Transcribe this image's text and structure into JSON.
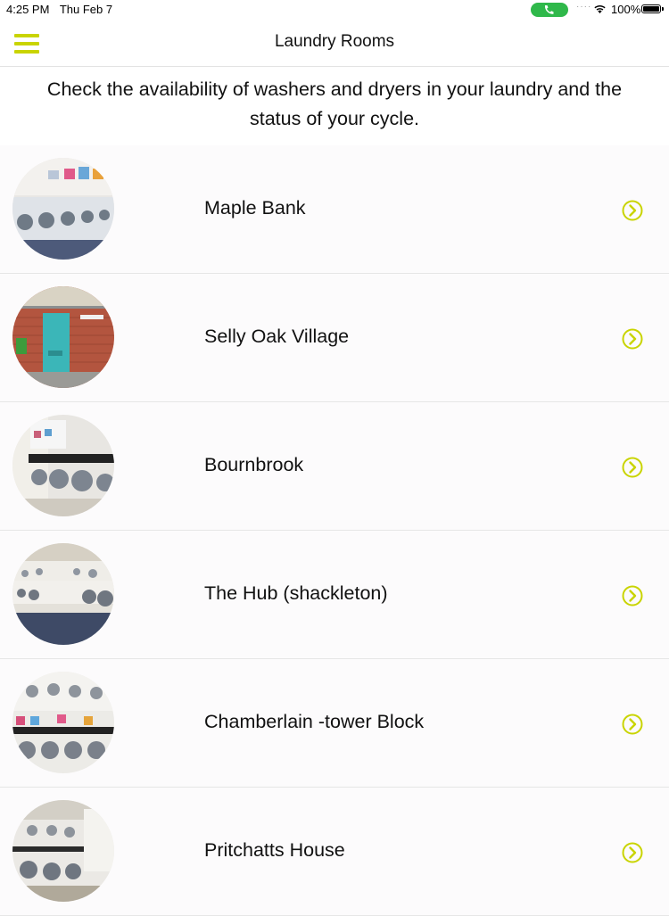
{
  "status_bar": {
    "time": "4:25 PM",
    "date": "Thu Feb 7",
    "battery": "100%"
  },
  "nav": {
    "title": "Laundry Rooms",
    "menu_icon": "hamburger-menu-icon"
  },
  "intro_text": "Check the availability of washers and dryers in your laundry and the status of your cycle.",
  "colors": {
    "accent": "#c9d400",
    "call_green": "#2fb84a"
  },
  "rooms": [
    {
      "name": "Maple Bank",
      "icon": "chevron-right-circle-icon"
    },
    {
      "name": "Selly Oak Village",
      "icon": "chevron-right-circle-icon"
    },
    {
      "name": "Bournbrook",
      "icon": "chevron-right-circle-icon"
    },
    {
      "name": "The Hub (shackleton)",
      "icon": "chevron-right-circle-icon"
    },
    {
      "name": "Chamberlain -tower Block",
      "icon": "chevron-right-circle-icon"
    },
    {
      "name": "Pritchatts House",
      "icon": "chevron-right-circle-icon"
    }
  ]
}
